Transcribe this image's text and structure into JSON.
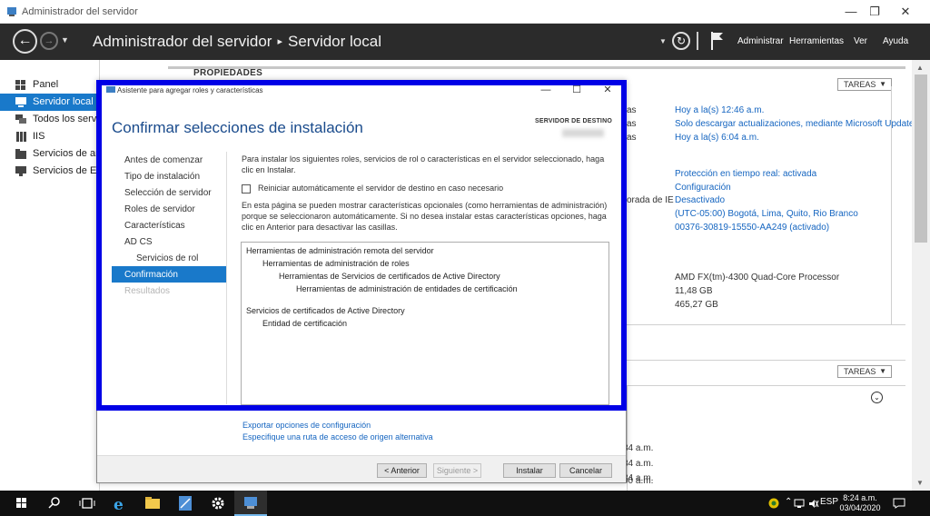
{
  "window": {
    "title": "Administrador del servidor",
    "minimize": "—",
    "maximize": "❐",
    "close": "✕"
  },
  "header": {
    "breadcrumb_root": "Administrador del servidor",
    "breadcrumb_sep": "▸",
    "breadcrumb_current": "Servidor local",
    "menu": {
      "manage": "Administrar",
      "tools": "Herramientas",
      "view": "Ver",
      "help": "Ayuda"
    }
  },
  "sidebar": {
    "items": [
      {
        "label": "Panel"
      },
      {
        "label": "Servidor local"
      },
      {
        "label": "Todos los servidores"
      },
      {
        "label": "IIS"
      },
      {
        "label": "Servicios de archivos"
      },
      {
        "label": "Servicios de Escritorio"
      }
    ]
  },
  "background": {
    "properties_title": "PROPIEDADES",
    "tasks_label": "TAREAS",
    "edge_texts": [
      "as",
      "as",
      "as",
      "orada de IE"
    ],
    "values_top": [
      "Hoy a la(s) 12:46 a.m.",
      "Solo descargar actualizaciones, mediante Microsoft Update",
      "Hoy a la(s) 6:04 a.m."
    ],
    "values_mid": [
      "Protección en tiempo real: activada",
      "Configuración",
      "Desactivado",
      "(UTC-05:00) Bogotá, Lima, Quito, Rio Branco",
      "00376-30819-15550-AA249 (activado)"
    ],
    "hardware": [
      "AMD FX(tm)-4300 Quad-Core Processor",
      "11,48 GB",
      "465,27 GB"
    ],
    "event_times": [
      "34 a.m.",
      "34 a.m.",
      "34 a.m.",
      "00 a.m."
    ]
  },
  "dialog": {
    "title": "Asistente para agregar roles y características",
    "heading": "Confirmar selecciones de instalación",
    "dest_label": "SERVIDOR DE DESTINO",
    "steps": [
      {
        "label": "Antes de comenzar"
      },
      {
        "label": "Tipo de instalación"
      },
      {
        "label": "Selección de servidor"
      },
      {
        "label": "Roles de servidor"
      },
      {
        "label": "Características"
      },
      {
        "label": "AD CS"
      },
      {
        "label": "Servicios de rol"
      },
      {
        "label": "Confirmación"
      },
      {
        "label": "Resultados"
      }
    ],
    "intro": "Para instalar los siguientes roles, servicios de rol o características en el servidor seleccionado, haga clic en Instalar.",
    "restart_checkbox": "Reiniciar automáticamente el servidor de destino en caso necesario",
    "note": "En esta página se pueden mostrar características opcionales (como herramientas de administración) porque se seleccionaron automáticamente. Si no desea instalar estas características opciones, haga clic en Anterior para desactivar las casillas.",
    "selections": [
      "Herramientas de administración remota del servidor",
      "Herramientas de administración de roles",
      "Herramientas de Servicios de certificados de Active Directory",
      "Herramientas de administración de entidades de certificación",
      "Servicios de certificados de Active Directory",
      "Entidad de certificación"
    ],
    "link_export": "Exportar opciones de configuración",
    "link_source": "Especifique una ruta de acceso de origen alternativa",
    "buttons": {
      "previous": "< Anterior",
      "next": "Siguiente >",
      "install": "Instalar",
      "cancel": "Cancelar"
    }
  },
  "taskbar": {
    "language": "ESP",
    "time": "8:24 a.m.",
    "date": "03/04/2020"
  },
  "colors": {
    "accent": "#1979ca",
    "header_bg": "#2b2b2b",
    "highlight_frame": "#0000e6",
    "link": "#1565c0"
  }
}
